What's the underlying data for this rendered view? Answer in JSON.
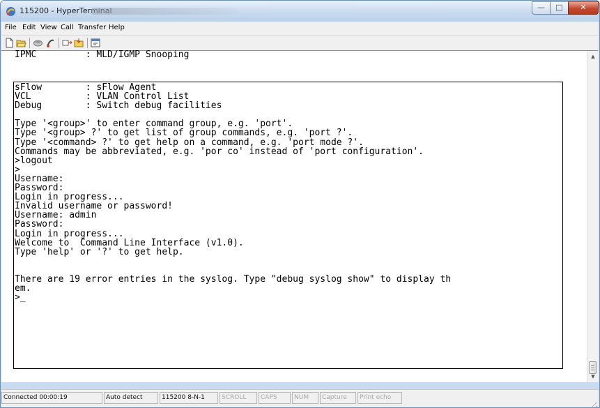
{
  "window": {
    "title": "115200 - HyperTerminal",
    "controls": {
      "minimize": "—",
      "maximize": "□",
      "close": "✕"
    }
  },
  "menu": {
    "items": [
      "File",
      "Edit",
      "View",
      "Call",
      "Transfer",
      "Help"
    ]
  },
  "toolbar": {
    "buttons": [
      "new-connection-icon",
      "open-icon",
      "disconnect-icon",
      "connect-icon",
      "send-icon",
      "receive-icon",
      "properties-icon"
    ]
  },
  "terminal": {
    "top_line": "IPMC         : MLD/IGMP Snooping",
    "lines": [
      "sFlow        : sFlow Agent",
      "VCL          : VLAN Control List",
      "Debug        : Switch debug facilities",
      "",
      "Type '<group>' to enter command group, e.g. 'port'.",
      "Type '<group> ?' to get list of group commands, e.g. 'port ?'.",
      "Type '<command> ?' to get help on a command, e.g. 'port mode ?'.",
      "Commands may be abbreviated, e.g. 'por co' instead of 'port configuration'.",
      ">logout",
      ">",
      "Username:",
      "Password:",
      "Login in progress...",
      "Invalid username or password!",
      "Username: admin",
      "Password:",
      "Login in progress...",
      "Welcome to  Command Line Interface (v1.0).",
      "Type 'help' or '?' to get help.",
      "",
      "",
      "There are 19 error entries in the syslog. Type \"debug syslog show\" to display th",
      "em.",
      ">_"
    ]
  },
  "statusbar": {
    "connected": "Connected 00:00:19",
    "detect": "Auto detect",
    "settings": "115200 8-N-1",
    "scroll": "SCROLL",
    "caps": "CAPS",
    "num": "NUM",
    "capture": "Capture",
    "print_echo": "Print echo"
  },
  "colors": {
    "title_bar": "#c6d9ee",
    "close_button": "#c3472c",
    "terminal_bg": "#ffffff",
    "terminal_text": "#000000"
  }
}
